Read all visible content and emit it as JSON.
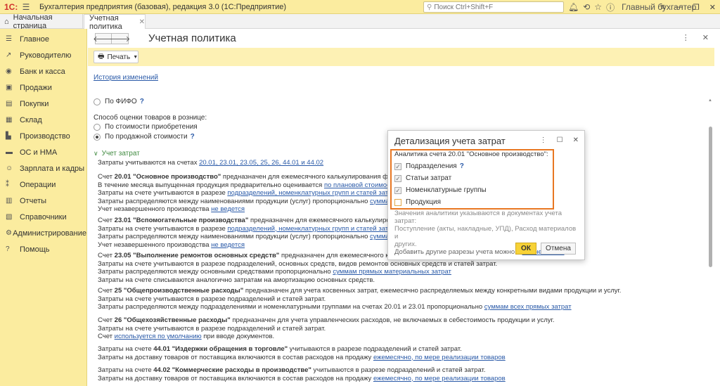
{
  "titlebar": {
    "logo": "1С:",
    "app_title": "Бухгалтерия предприятия (базовая), редакция 3.0  (1С:Предприятие)",
    "search_placeholder": "Поиск Ctrl+Shift+F",
    "user": "Главный бухгалтер"
  },
  "tabs": {
    "home_label": "Начальная страница",
    "active_label": "Учетная политика"
  },
  "sidebar": {
    "items": [
      {
        "label": "Главное",
        "icon": "menu-icon"
      },
      {
        "label": "Руководителю",
        "icon": "chart-icon"
      },
      {
        "label": "Банк и касса",
        "icon": "bank-icon"
      },
      {
        "label": "Продажи",
        "icon": "sales-icon"
      },
      {
        "label": "Покупки",
        "icon": "cart-icon"
      },
      {
        "label": "Склад",
        "icon": "warehouse-icon"
      },
      {
        "label": "Производство",
        "icon": "factory-icon"
      },
      {
        "label": "ОС и НМА",
        "icon": "truck-icon"
      },
      {
        "label": "Зарплата и кадры",
        "icon": "people-icon"
      },
      {
        "label": "Операции",
        "icon": "operations-icon"
      },
      {
        "label": "Отчеты",
        "icon": "reports-icon"
      },
      {
        "label": "Справочники",
        "icon": "book-icon"
      },
      {
        "label": "Администрирование",
        "icon": "gear-icon"
      },
      {
        "label": "Помощь",
        "icon": "help-icon"
      }
    ]
  },
  "main": {
    "page_title": "Учетная политика",
    "print_label": "Печать",
    "history_link": "История изменений",
    "fifo_label": "По ФИФО",
    "retail_caption": "Способ оценки товаров в рознице:",
    "retail_opt1": "По стоимости приобретения",
    "retail_opt2": "По продажной стоимости",
    "group_label": "Учет затрат",
    "l1a": "Затраты учитываются на счетах ",
    "l1b": "20.01, 23.01, 23.05, 25, 26, 44.01 и 44.02",
    "s1_a": "Счет ",
    "s1_b": "20.01 \"Основное производство\"",
    "s1_c": " предназначен для ежемесячного калькулирования фактиче",
    "s1_l2a": "В течение месяца выпущенная продукция предварительно оценивается ",
    "s1_l2b": "по плановой стоимости",
    "s1_l3a": "Затраты на счете учитываются в разрезе ",
    "s1_l3b": "подразделений, номенклатурных групп и статей затрат",
    "s1_l4a": "Затраты распределяются между наименованиями продукции (услуг) пропорционально ",
    "s1_l4b": "суммам план",
    "s1_l5a": "Учет незавершенного производства ",
    "s1_l5b": "не ведется",
    "s2_a": "Счет ",
    "s2_b": "23.01 \"Вспомогательные производства\"",
    "s2_c": " предназначен для ежемесячного калькулирования",
    "s2_l2a": "Затраты на счете учитываются в разрезе ",
    "s2_l2b": "подразделений, номенклатурных групп и статей затрат",
    "s2_l3a": "Затраты распределяются между наименованиями продукции (услуг) пропорционально ",
    "s2_l3b": "суммам план",
    "s2_l4a": "Учет незавершенного производства ",
    "s2_l4b": "не ведется",
    "s3_a": "Счет ",
    "s3_b": "23.05 \"Выполнение ремонтов основных средств\"",
    "s3_c": " предназначен для ежемесячного калькул",
    "s3_l2": "Затраты на счете учитываются в разрезе подразделений, основных средств, видов ремонтов основных средств и статей затрат.",
    "s3_l3a": "Затраты распределяются между основными средствами пропорционально ",
    "s3_l3b": "суммам прямых материальных затрат",
    "s3_l4": "Затраты на счете списываются аналогично затратам на амортизацию основных средств.",
    "s4_a": "Счет ",
    "s4_b": "25 \"Общепроизводственные расходы\"",
    "s4_c": " предназначен для учета косвенных затрат, ежемесячно распределяемых между конкретными видами продукции и услуг.",
    "s4_l2": "Затраты на счете учитываются в разрезе подразделений и статей затрат.",
    "s4_l3a": "Затраты распределяются между подразделениями и номенклатурными группами на счетах 20.01 и 23.01 пропорционально ",
    "s4_l3b": "суммам всех прямых затрат",
    "s5_a": "Счет ",
    "s5_b": "26 \"Общехозяйственные расходы\"",
    "s5_c": " предназначен для учета управленческих расходов, не включаемых в себестоимость продукции и услуг.",
    "s5_l2": "Затраты на счете учитываются в разрезе подразделений и статей затрат.",
    "s5_l3a": "Счет ",
    "s5_l3b": "используется по умолчанию",
    "s5_l3c": " при вводе документов.",
    "s6_a": "Затраты на счете ",
    "s6_b": "44.01 \"Издержки обращения в торговле\"",
    "s6_c": " учитываются в разрезе подразделений и статей затрат.",
    "s6_l2a": "Затраты на доставку товаров от поставщика включаются в состав расходов на продажу ",
    "s6_l2b": "ежемесячно, по мере реализации товаров",
    "s7_a": "Затраты на счете ",
    "s7_b": "44.02 \"Коммерческие расходы в производстве\"",
    "s7_c": " учитываются в разрезе подразделений и статей затрат.",
    "s7_l2a": "Затраты на доставку товаров от поставщика включаются в состав расходов на продажу ",
    "s7_l2b": "ежемесячно, по мере реализации товаров"
  },
  "dialog": {
    "title": "Детализация учета затрат",
    "caption": "Аналитика счета 20.01 \"Основное производство\":",
    "checks": [
      {
        "label": "Подразделения",
        "checked": true,
        "help": "?"
      },
      {
        "label": "Статьи затрат",
        "checked": true
      },
      {
        "label": "Номенклатурные группы",
        "checked": true
      },
      {
        "label": "Продукция",
        "checked": false
      }
    ],
    "note_l1": "Значения аналитики указываются в документах учета затрат:",
    "note_l2": "Поступление (акты, накладные, УПД), Расход материалов и",
    "note_l3": "других.",
    "add_text": "Добавить другие разрезы учета можно в ",
    "add_link": "Плане счетов",
    "ok_label": "ОК",
    "cancel_label": "Отмена"
  },
  "colors": {
    "accent_yellow": "#fbec9f",
    "highlight_orange": "#e87722",
    "link_blue": "#2a5aa8",
    "ok_button": "#f7d237"
  }
}
